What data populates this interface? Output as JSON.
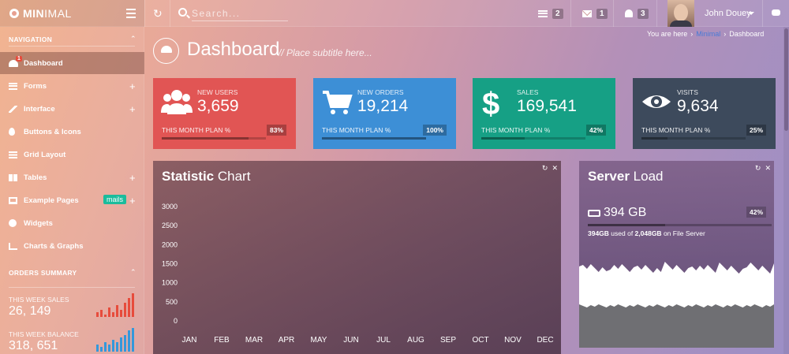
{
  "brand": {
    "bold": "MIN",
    "thin": "IMAL"
  },
  "search": {
    "placeholder": "Search..."
  },
  "topbar": {
    "tasks_count": "2",
    "mail_count": "1",
    "notifications_count": "3",
    "user_name": "John Douey"
  },
  "sidebar": {
    "nav_heading": "NAVIGATION",
    "items": [
      {
        "label": "Dashboard",
        "icon": "dashboard-icon",
        "badge": "1"
      },
      {
        "label": "Forms",
        "icon": "list-icon"
      },
      {
        "label": "Interface",
        "icon": "pencil-icon"
      },
      {
        "label": "Buttons & Icons",
        "icon": "drop-icon"
      },
      {
        "label": "Grid Layout",
        "icon": "grid-icon"
      },
      {
        "label": "Tables",
        "icon": "table-icon"
      },
      {
        "label": "Example Pages",
        "icon": "monitor-icon",
        "badge": "mails"
      },
      {
        "label": "Widgets",
        "icon": "play-icon"
      },
      {
        "label": "Charts & Graphs",
        "icon": "chart-icon"
      }
    ],
    "orders_heading": "ORDERS SUMMARY",
    "summary": [
      {
        "label": "THIS WEEK SALES",
        "value": "26, 149",
        "color": "#e74c3c",
        "bars": [
          2,
          3,
          1,
          4,
          2,
          5,
          3,
          6,
          8,
          10
        ]
      },
      {
        "label": "THIS WEEK BALANCE",
        "value": "318, 651",
        "color": "#3498db",
        "bars": [
          3,
          2,
          4,
          3,
          5,
          4,
          6,
          7,
          9,
          10
        ]
      }
    ]
  },
  "header": {
    "title": "Dashboard",
    "subtitle": "// Place subtitle here...",
    "breadcrumb_prefix": "You are here",
    "breadcrumb_link": "Minimal",
    "breadcrumb_current": "Dashboard"
  },
  "stats": [
    {
      "label": "NEW USERS",
      "value": "3,659",
      "plan": "THIS MONTH PLAN %",
      "pct": "83%",
      "progress": 0.83,
      "color": "#e15554",
      "icon": "users-icon"
    },
    {
      "label": "NEW ORDERS",
      "value": "19,214",
      "plan": "THIS MONTH PLAN %",
      "pct": "100%",
      "progress": 1.0,
      "color": "#3d8fd6",
      "icon": "cart-icon"
    },
    {
      "label": "SALES",
      "value": "169,541",
      "plan": "THIS MONTH PLAN %",
      "pct": "42%",
      "progress": 0.42,
      "color": "#16a085",
      "icon": "dollar-icon"
    },
    {
      "label": "VISITS",
      "value": "9,634",
      "plan": "THIS MONTH PLAN %",
      "pct": "25%",
      "progress": 0.25,
      "color": "#3d4a5c",
      "icon": "eye-icon"
    }
  ],
  "statistic_chart": {
    "title_bold": "Statistic",
    "title_rest": " Chart"
  },
  "chart_data": {
    "type": "line",
    "categories": [
      "JAN",
      "FEB",
      "MAR",
      "APR",
      "MAY",
      "JUN",
      "JUL",
      "AUG",
      "SEP",
      "OCT",
      "NOV",
      "DEC"
    ],
    "y_ticks": [
      "3000",
      "2500",
      "2000",
      "1500",
      "1000",
      "500",
      "0"
    ],
    "ylim": [
      0,
      3000
    ],
    "series": [],
    "grid": false,
    "legend": "none"
  },
  "server_load": {
    "title_bold": "Server",
    "title_rest": " Load",
    "used": "394 GB",
    "pct": "42%",
    "progress": 0.42,
    "used_bold": "394GB",
    "used_of": " used of ",
    "total_bold": "2,048GB",
    "on_text": " on File Server"
  }
}
